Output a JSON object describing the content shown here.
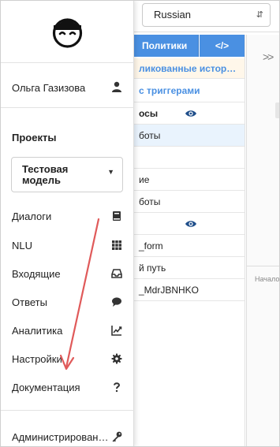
{
  "header": {
    "language_select": "Russian",
    "tab_policies": "Политики",
    "tab_code": "</>"
  },
  "list": {
    "rows": [
      "ликованные истор…",
      "с триггерами",
      "осы",
      "боты",
      "",
      "ие",
      "боты",
      "",
      "_form",
      "й путь",
      "_MdrJBNHKO"
    ]
  },
  "right_pane": {
    "label": "Начало"
  },
  "sidebar": {
    "user_name": "Ольга Газизова",
    "projects_heading": "Проекты",
    "model_select_value": "Тестовая модель",
    "nav": [
      {
        "label": "Диалоги",
        "icon": "book-icon"
      },
      {
        "label": "NLU",
        "icon": "grid-icon"
      },
      {
        "label": "Входящие",
        "icon": "inbox-icon"
      },
      {
        "label": "Ответы",
        "icon": "speech-bubble-icon"
      },
      {
        "label": "Аналитика",
        "icon": "chart-line-icon"
      },
      {
        "label": "Настройки",
        "icon": "gear-icon"
      },
      {
        "label": "Документация",
        "icon": "question-icon"
      },
      {
        "label": "Администрирован…",
        "icon": "key-icon"
      }
    ]
  },
  "colors": {
    "accent_blue": "#4a90e2",
    "annotation_arrow": "#e05a5a",
    "text": "#222222"
  }
}
